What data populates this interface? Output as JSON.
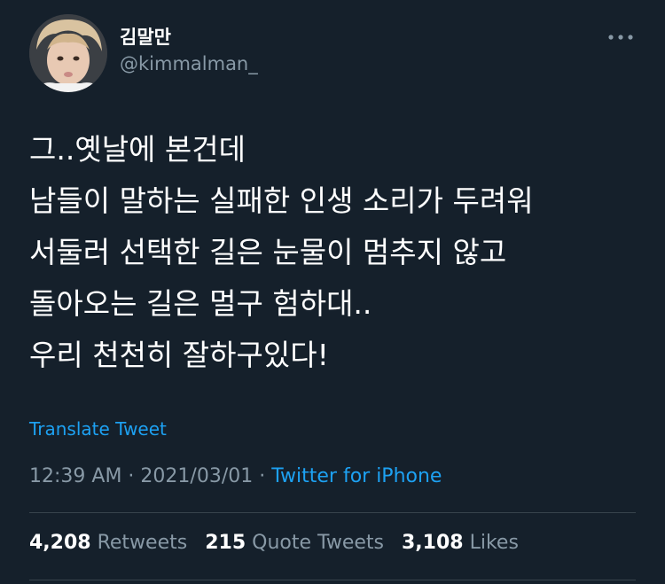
{
  "user": {
    "display_name": "김말만",
    "handle": "@kimmalman_",
    "avatar_icon": "profile-photo"
  },
  "tweet": {
    "lines": [
      "그..옛날에 본건데",
      "남들이 말하는 실패한 인생 소리가 두려워",
      "서둘러 선택한 길은 눈물이 멈추지 않고",
      "돌아오는 길은 멀구 험하대..",
      "우리 천천히 잘하구있다!"
    ],
    "translate_label": "Translate Tweet",
    "time": "12:39 AM",
    "separator": " · ",
    "date": "2021/03/01",
    "source": "Twitter for iPhone"
  },
  "stats": {
    "retweets_count": "4,208",
    "retweets_label": "Retweets",
    "quote_count": "215",
    "quote_label": "Quote Tweets",
    "likes_count": "3,108",
    "likes_label": "Likes"
  },
  "colors": {
    "background": "#15202b",
    "accent": "#1da1f2",
    "muted": "#8899a6",
    "divider": "#38444d"
  }
}
